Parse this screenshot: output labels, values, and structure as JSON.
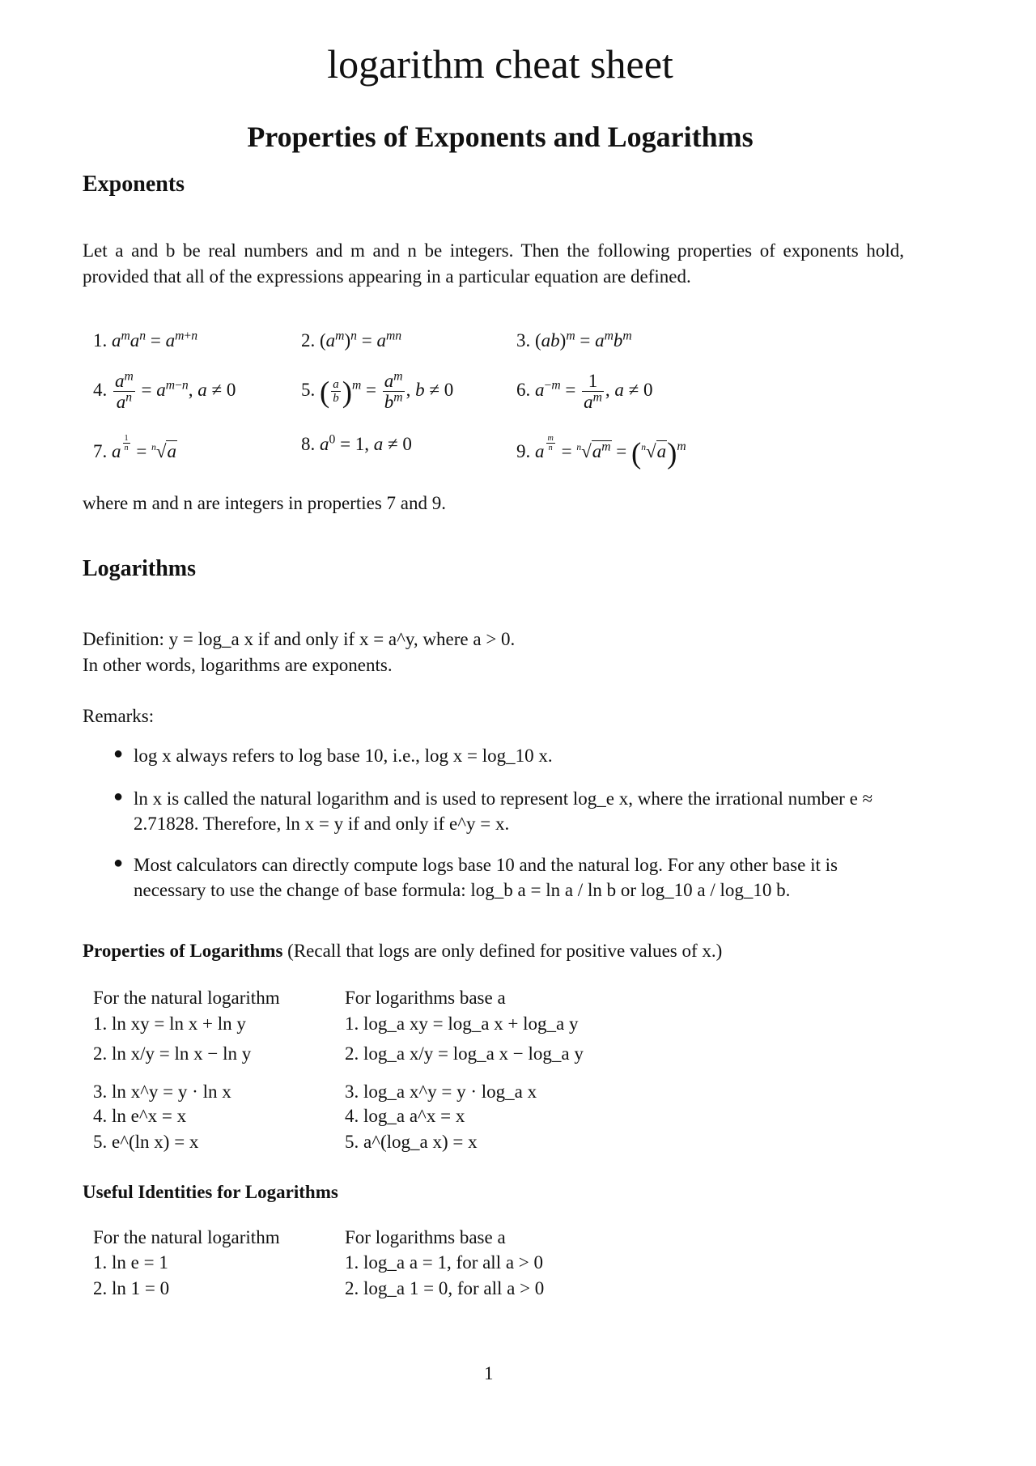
{
  "document": {
    "title": "logarithm cheat sheet",
    "heading": "Properties of Exponents and Logarithms",
    "page_number": "1"
  },
  "exponents": {
    "heading": "Exponents",
    "intro": "Let a and b be real numbers and m and n be integers. Then the following properties of exponents hold, provided that all of the expressions appearing in a particular equation are defined.",
    "properties": [
      {
        "num": "1.",
        "text": "a^m a^n = a^(m+n)"
      },
      {
        "num": "2.",
        "text": "(a^m)^n = a^(mn)"
      },
      {
        "num": "3.",
        "text": "(ab)^m = a^m b^m"
      },
      {
        "num": "4.",
        "text": "a^m / a^n = a^(m−n), a ≠ 0"
      },
      {
        "num": "5.",
        "text": "(a/b)^m = a^m / b^m, b ≠ 0"
      },
      {
        "num": "6.",
        "text": "a^(−m) = 1 / a^m, a ≠ 0"
      },
      {
        "num": "7.",
        "text": "a^(1/n) = ⁿ√a"
      },
      {
        "num": "8.",
        "text": "a^0 = 1, a ≠ 0"
      },
      {
        "num": "9.",
        "text": "a^(m/n) = ⁿ√(a^m) = (ⁿ√a)^m"
      }
    ],
    "note": "where m and n are integers in properties 7 and 9."
  },
  "logarithms": {
    "heading": "Logarithms",
    "definition": "Definition: y = log_a x if and only if x = a^y, where a > 0.",
    "definition_note": "In other words, logarithms are exponents.",
    "remarks_label": "Remarks:",
    "remarks": [
      "log x always refers to log base 10, i.e., log x = log_10 x.",
      "ln x is called the natural logarithm and is used to represent log_e x, where the irrational number e ≈ 2.71828. Therefore, ln x = y if and only if e^y = x.",
      "Most calculators can directly compute logs base 10 and the natural log. For any other base it is necessary to use the change of base formula: log_b a = ln a / ln b or log_10 a / log_10 b."
    ]
  },
  "properties_of_logarithms": {
    "heading": "Properties of Logarithms",
    "heading_note": "(Recall that logs are only defined for positive values of x.)",
    "columns": [
      "For the natural logarithm",
      "For logarithms base a"
    ],
    "natural": [
      "1. ln xy = ln x + ln y",
      "2. ln x/y = ln x − ln y",
      "3. ln x^y = y · ln x",
      "4. ln e^x = x",
      "5. e^(ln x) = x"
    ],
    "base_a": [
      "1. log_a xy = log_a x + log_a y",
      "2. log_a x/y = log_a x − log_a y",
      "3. log_a x^y = y · log_a x",
      "4. log_a a^x = x",
      "5. a^(log_a x) = x"
    ]
  },
  "useful_identities": {
    "heading": "Useful Identities for Logarithms",
    "columns": [
      "For the natural logarithm",
      "For logarithms base a"
    ],
    "natural": [
      "1. ln e = 1",
      "2. ln 1 = 0"
    ],
    "base_a": [
      "1. log_a a = 1, for all a > 0",
      "2. log_a 1 = 0, for all a > 0"
    ]
  },
  "bullet_icon": "bullet-dot"
}
